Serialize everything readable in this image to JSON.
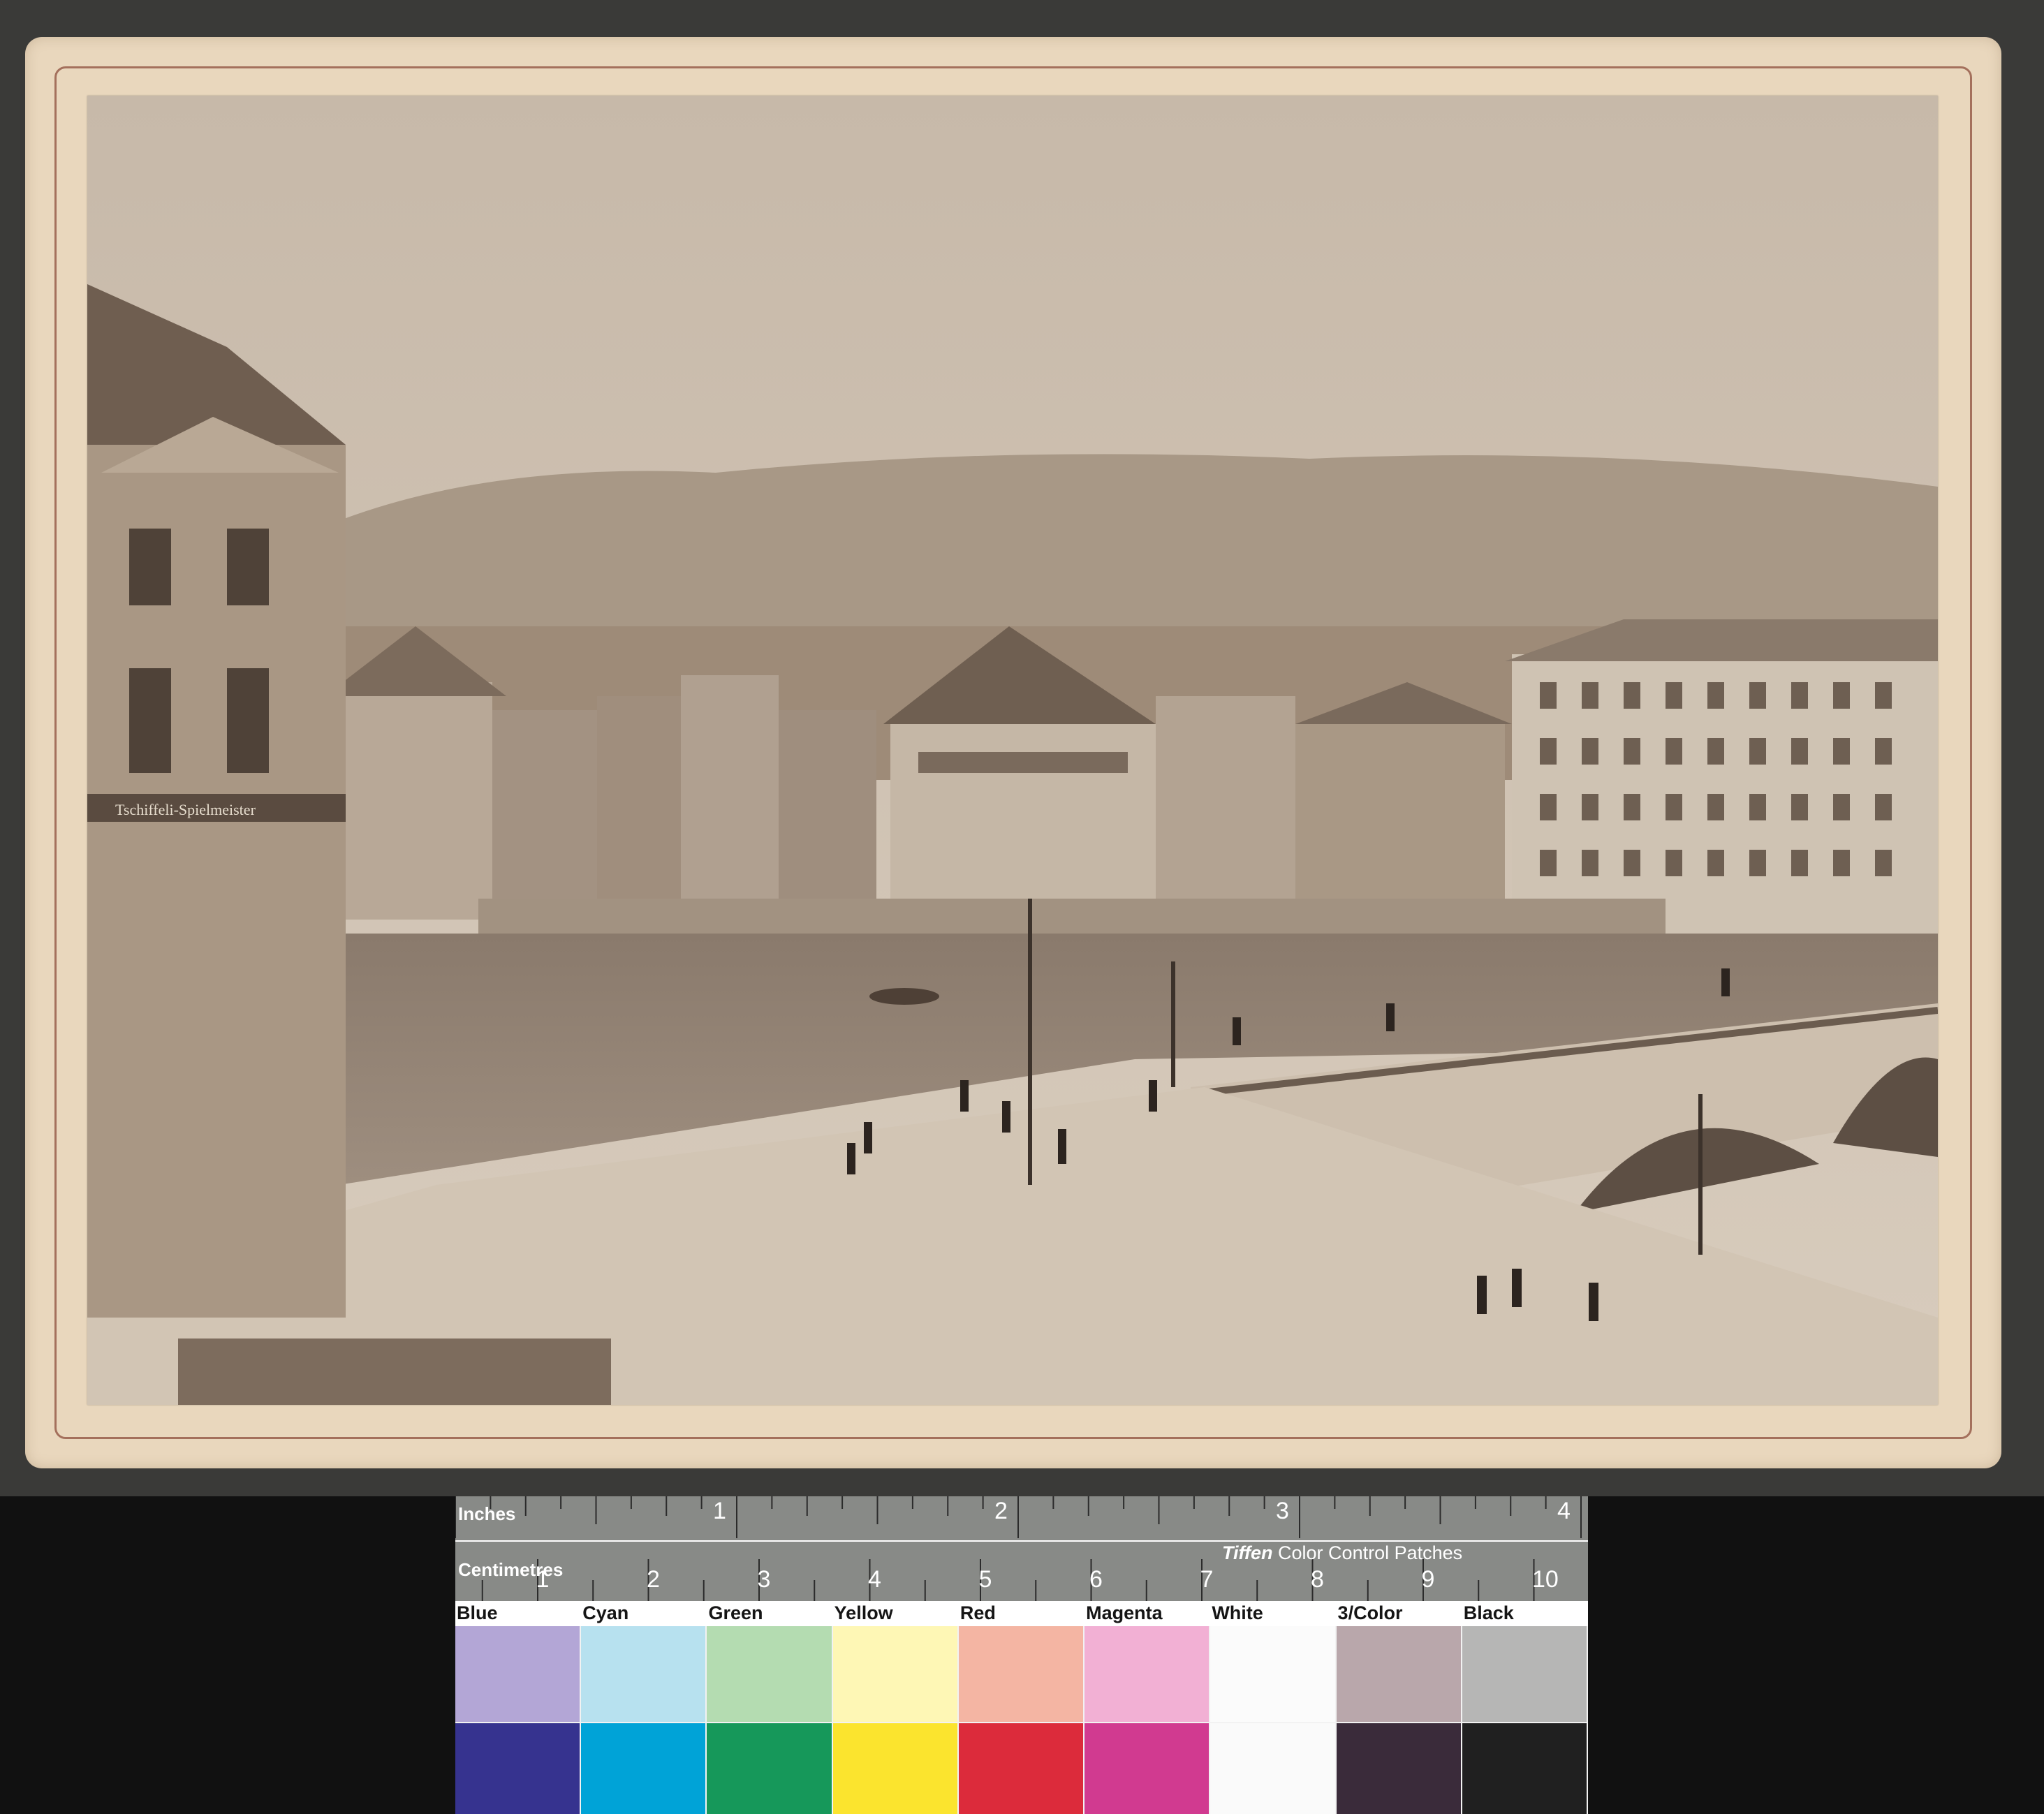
{
  "photograph": {
    "shop_sign": "Tschiffeli-Spielmeister"
  },
  "color_target": {
    "inches_label": "Inches",
    "centimetres_label": "Centimetres",
    "brand": "Tiffen",
    "brand_suffix": "Color Control Patches",
    "inch_numbers": [
      "1",
      "2",
      "3",
      "4"
    ],
    "cm_numbers": [
      "1",
      "2",
      "3",
      "4",
      "5",
      "6",
      "7",
      "8",
      "9",
      "10"
    ],
    "patches": [
      {
        "label": "Blue",
        "light": "#b3a6d6",
        "dark": "#36338f"
      },
      {
        "label": "Cyan",
        "light": "#b7e1ef",
        "dark": "#00a3d7"
      },
      {
        "label": "Green",
        "light": "#b4dcb1",
        "dark": "#16985a"
      },
      {
        "label": "Yellow",
        "light": "#fef7b5",
        "dark": "#fbe42e"
      },
      {
        "label": "Red",
        "light": "#f4b5a3",
        "dark": "#dc2b3b"
      },
      {
        "label": "Magenta",
        "light": "#f2b0d4",
        "dark": "#d13a90"
      },
      {
        "label": "White",
        "light": "#fbfbfb",
        "dark": "#fafafa"
      },
      {
        "label": "3/Color",
        "light": "#b9a7ab",
        "dark": "#3a2b3a"
      },
      {
        "label": "Black",
        "light": "#b6b6b5",
        "dark": "#202020"
      }
    ]
  }
}
